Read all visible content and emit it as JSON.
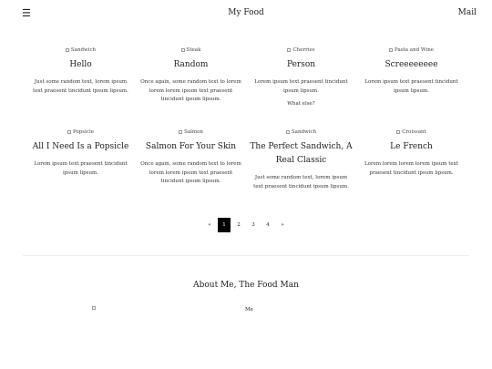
{
  "header": {
    "menu_icon": "☰",
    "title": "My Food",
    "mail": "Mail"
  },
  "cards": [
    {
      "img_alt": "Sandwich",
      "title": "Hello",
      "desc": "Just some random text, lorem ipsum text praesent tincidunt ipsum lipsum."
    },
    {
      "img_alt": "Steak",
      "title": "Random",
      "desc": "Once again, some random text to lorem lorem lorem ipsum text praesent tincidunt ipsum lipsum."
    },
    {
      "img_alt": "Cherries",
      "title": "Person",
      "desc": "Lorem ipsum text praesent tincidunt ipsum lipsum.",
      "extra": "What else?"
    },
    {
      "img_alt": "Pasta and Wine",
      "title": "Screeeeeeee",
      "desc": "Lorem ipsum text praesent tincidunt ipsum lipsum."
    },
    {
      "img_alt": "Popsicle",
      "title": "All I Need Is a Popsicle",
      "desc": "Lorem ipsum text praesent tincidunt ipsum lipsum."
    },
    {
      "img_alt": "Salmon",
      "title": "Salmon For Your Skin",
      "desc": "Once again, some random text to lorem lorem lorem ipsum text praesent tincidunt ipsum lipsum."
    },
    {
      "img_alt": "Sandwich",
      "title": "The Perfect Sandwich, A Real Classic",
      "desc": "Just some random text, lorem ipsum text praesent tincidunt ipsum lipsum."
    },
    {
      "img_alt": "Croissant",
      "title": "Le French",
      "desc": "Lorem lorem lorem lorem ipsum text praesent tincidunt ipsum lipsum."
    }
  ],
  "pagination": {
    "prev": "«",
    "pages": [
      "1",
      "2",
      "3",
      "4"
    ],
    "next": "»",
    "active": 0
  },
  "about": {
    "title": "About Me, The Food Man",
    "img_alt": "Me"
  }
}
